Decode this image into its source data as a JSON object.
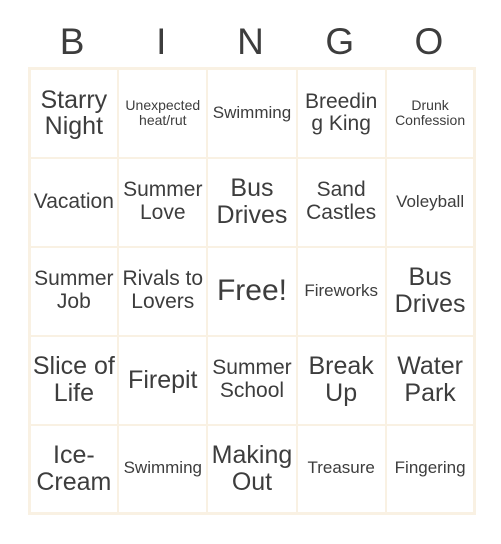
{
  "card": {
    "title_letters": [
      "B",
      "I",
      "N",
      "G",
      "O"
    ],
    "colors": {
      "grid_border": "#f9f1e3",
      "text": "#3d3d3d",
      "background": "#ffffff"
    },
    "rows": [
      [
        {
          "label": "Starry Night",
          "size": "lg"
        },
        {
          "label": "Unexpected heat/rut",
          "size": "xs"
        },
        {
          "label": "Swimming",
          "size": "sm"
        },
        {
          "label": "Breeding King",
          "size": "md"
        },
        {
          "label": "Drunk Confession",
          "size": "xs"
        }
      ],
      [
        {
          "label": "Vacation",
          "size": "md"
        },
        {
          "label": "Summer Love",
          "size": "md"
        },
        {
          "label": "Bus Drives",
          "size": "lg"
        },
        {
          "label": "Sand Castles",
          "size": "md"
        },
        {
          "label": "Voleyball",
          "size": "sm"
        }
      ],
      [
        {
          "label": "Summer Job",
          "size": "md"
        },
        {
          "label": "Rivals to Lovers",
          "size": "md"
        },
        {
          "label": "Free!",
          "size": "xl"
        },
        {
          "label": "Fireworks",
          "size": "sm"
        },
        {
          "label": "Bus Drives",
          "size": "lg"
        }
      ],
      [
        {
          "label": "Slice of Life",
          "size": "lg"
        },
        {
          "label": "Firepit",
          "size": "lg"
        },
        {
          "label": "Summer School",
          "size": "md"
        },
        {
          "label": "Break Up",
          "size": "lg"
        },
        {
          "label": "Water Park",
          "size": "lg"
        }
      ],
      [
        {
          "label": "Ice-Cream",
          "size": "lg"
        },
        {
          "label": "Swimming",
          "size": "sm"
        },
        {
          "label": "Making Out",
          "size": "lg"
        },
        {
          "label": "Treasure",
          "size": "sm"
        },
        {
          "label": "Fingering",
          "size": "sm"
        }
      ]
    ]
  }
}
